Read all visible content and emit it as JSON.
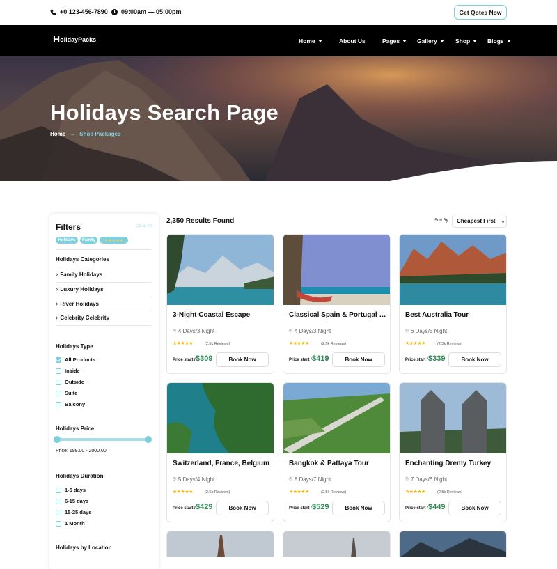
{
  "topbar": {
    "phone": "+0 123-456-7890",
    "hours": "09:00am — 05:00pm",
    "cta": "Get Qotes Now"
  },
  "nav": {
    "logo_initial": "H",
    "logo_text": "olidayPacks",
    "items": [
      {
        "label": "Home"
      },
      {
        "label": "About Us"
      },
      {
        "label": "Pages"
      },
      {
        "label": "Gallery"
      },
      {
        "label": "Shop"
      },
      {
        "label": "Blogs"
      }
    ]
  },
  "hero": {
    "title": "Holidays Search Page",
    "breadcrumb_home": "Home",
    "breadcrumb_arrow": "→",
    "breadcrumb_current": "Shop Packages"
  },
  "filters": {
    "title": "Filters",
    "clear": "Clear All",
    "tags": [
      "Holidays",
      "Family",
      "★★★★★"
    ],
    "categories_title": "Holidays Categories",
    "categories": [
      "Family Holidays",
      "Luxury Holidays",
      "River Holidays",
      "Celebrity Celebrity"
    ],
    "type_title": "Holidays Type",
    "types": [
      {
        "label": "All Products",
        "checked": true
      },
      {
        "label": "Inside",
        "checked": false
      },
      {
        "label": "Outside",
        "checked": false
      },
      {
        "label": "Suite",
        "checked": false
      },
      {
        "label": "Balcony",
        "checked": false
      }
    ],
    "price_title": "Holidays Price",
    "price_range": "Price: 199.00 - 2000.00",
    "duration_title": "Holidays Duration",
    "durations": [
      "1-5 days",
      "6-15 days",
      "15-25 days",
      "1 Month"
    ],
    "location_title": "Holidays by Location"
  },
  "results": {
    "count_text": "2,350 Results Found",
    "sort_label": "Sort By",
    "sort_value": "Cheapest First"
  },
  "cards": [
    {
      "title": "3-Night Coastal Escape",
      "duration": "4 Days/3 Night",
      "reviews": "(2.5k Reviews)",
      "price_label": "Price start /",
      "price": "$309",
      "button": "Book Now",
      "rating": 5
    },
    {
      "title": "Classical Spain & Portugal Tour",
      "duration": "4 Days/3 Night",
      "reviews": "(2.5k Reviews)",
      "price_label": "Price start /",
      "price": "$419",
      "button": "Book Now",
      "rating": 5
    },
    {
      "title": "Best Australia Tour",
      "duration": "6 Days/5 Night",
      "reviews": "(2.5k Reviews)",
      "price_label": "Price start /",
      "price": "$339",
      "button": "Book Now",
      "rating": 5
    },
    {
      "title": "Switzerland, France, Belgium",
      "duration": "5 Days/4 Night",
      "reviews": "(2.5k Reviews)",
      "price_label": "Price start /",
      "price": "$429",
      "button": "Book Now",
      "rating": 5
    },
    {
      "title": "Bangkok & Pattaya Tour",
      "duration": "8 Days/7 Night",
      "reviews": "(2.5k Reviews)",
      "price_label": "Price start /",
      "price": "$529",
      "button": "Book Now",
      "rating": 5
    },
    {
      "title": "Enchanting Dremy Turkey",
      "duration": "7 Days/6 Night",
      "reviews": "(2.5k Reviews)",
      "price_label": "Price start /",
      "price": "$449",
      "button": "Book Now",
      "rating": 5
    }
  ],
  "colors": {
    "accent": "#7fd0dc",
    "price": "#2e8b57",
    "star": "#f4b400",
    "nav_bg": "#000000"
  }
}
